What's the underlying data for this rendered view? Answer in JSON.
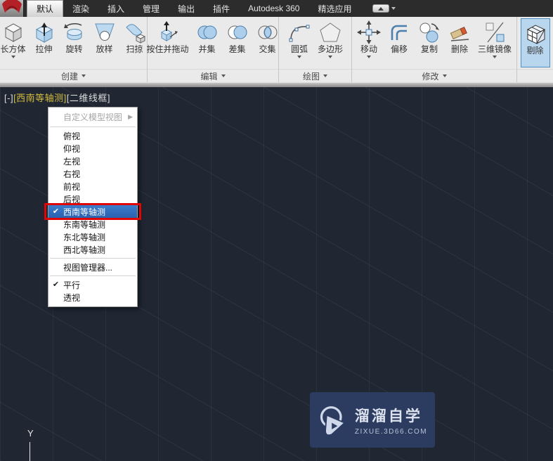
{
  "tab_bar": {
    "tabs": [
      {
        "label": "默认",
        "active": true
      },
      {
        "label": "渲染"
      },
      {
        "label": "插入"
      },
      {
        "label": "管理"
      },
      {
        "label": "输出"
      },
      {
        "label": "插件"
      },
      {
        "label": "Autodesk 360"
      },
      {
        "label": "精选应用"
      }
    ]
  },
  "ribbon": {
    "panels": [
      {
        "label": "创建",
        "tools": [
          {
            "label": "长方体",
            "icon": "box-icon",
            "dropdown": true
          },
          {
            "label": "拉伸",
            "icon": "extrude-icon"
          },
          {
            "label": "旋转",
            "icon": "revolve-icon"
          },
          {
            "label": "放样",
            "icon": "loft-icon"
          },
          {
            "label": "扫掠",
            "icon": "sweep-icon"
          }
        ]
      },
      {
        "label": "编辑",
        "tools": [
          {
            "label": "按住并拖动",
            "icon": "presspull-icon"
          },
          {
            "label": "并集",
            "icon": "union-icon"
          },
          {
            "label": "差集",
            "icon": "subtract-icon"
          },
          {
            "label": "交集",
            "icon": "intersect-icon"
          }
        ]
      },
      {
        "label": "绘图",
        "tools": [
          {
            "label": "圆弧",
            "icon": "arc-icon",
            "dropdown": true
          },
          {
            "label": "多边形",
            "icon": "polygon-icon",
            "dropdown": true
          }
        ]
      },
      {
        "label": "修改",
        "tools": [
          {
            "label": "移动",
            "icon": "move-icon",
            "dropdown": true
          },
          {
            "label": "偏移",
            "icon": "offset-icon"
          },
          {
            "label": "复制",
            "icon": "copy-icon"
          },
          {
            "label": "删除",
            "icon": "erase-icon"
          },
          {
            "label": "三维镜像",
            "icon": "mirror3d-icon",
            "dropdown": true
          }
        ]
      },
      {
        "label": "",
        "tools": [
          {
            "label": "剔除",
            "icon": "cull-icon",
            "active": true
          }
        ]
      }
    ]
  },
  "viewport": {
    "controls": [
      "[-]",
      "[西南等轴测]",
      "[二维线框]"
    ],
    "axis_label": "Y"
  },
  "context_menu": {
    "items": [
      {
        "label": "自定义模型视图",
        "disabled": true,
        "has_submenu": true
      },
      {
        "label": "俯视"
      },
      {
        "label": "仰视"
      },
      {
        "label": "左视"
      },
      {
        "label": "右视"
      },
      {
        "label": "前视"
      },
      {
        "label": "后视"
      },
      {
        "label": "西南等轴测",
        "checked": true,
        "highlighted": true,
        "red_boxed": true
      },
      {
        "label": "东南等轴测"
      },
      {
        "label": "东北等轴测"
      },
      {
        "label": "西北等轴测"
      },
      {
        "label": "视图管理器..."
      },
      {
        "label": "平行",
        "checked": true
      },
      {
        "label": "透视"
      }
    ]
  },
  "watermark": {
    "title": "溜溜自学",
    "url": "zixue.3d66.com"
  },
  "icons": {
    "submenu_arrow": "submenu-arrow-icon",
    "check": "check-icon",
    "dropdown": "chevron-down-icon",
    "minimize_ribbon": "minimize-ribbon-icon"
  },
  "colors": {
    "menu_highlight": "#2e6bbd",
    "red_box": "#e00505",
    "canvas_bg": "#202733",
    "view_label_yellow": "#d3bd3f",
    "cull_active_bg": "#b9d6ef",
    "watermark_bg": "#2c3b60"
  }
}
